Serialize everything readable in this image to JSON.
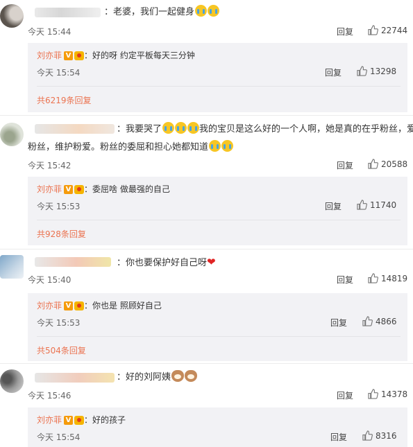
{
  "comments": [
    {
      "text": "：老婆，我们一起健身",
      "time": "今天 15:44",
      "reply_label": "回复",
      "likes": "22744",
      "reply": {
        "name": "刘亦菲",
        "text": "：好的呀 约定平板每天三分钟",
        "time": "今天 15:54",
        "reply_label": "回复",
        "likes": "13298"
      },
      "more": "共6219条回复"
    },
    {
      "text_a": "：我要哭了",
      "text_b": "我的宝贝是这么好的一个人啊，她是真的在乎粉丝，爱",
      "text_c": "粉丝，维护粉爱。粉丝的委屈和担心她都知道",
      "time": "今天 15:42",
      "reply_label": "回复",
      "likes": "20588",
      "reply": {
        "name": "刘亦菲",
        "text": "：委屈啥 做最强的自己",
        "time": "今天 15:53",
        "reply_label": "回复",
        "likes": "11740"
      },
      "more": "共928条回复"
    },
    {
      "text": "：你也要保护好自己呀",
      "time": "今天 15:40",
      "reply_label": "回复",
      "likes": "14819",
      "reply": {
        "name": "刘亦菲",
        "text": "：你也是 照顾好自己",
        "time": "今天 15:53",
        "reply_label": "回复",
        "likes": "4866"
      },
      "more": "共504条回复"
    },
    {
      "text": "：好的刘阿姨",
      "time": "今天 15:46",
      "reply_label": "回复",
      "likes": "14378",
      "reply": {
        "name": "刘亦菲",
        "text": "：好的孩子",
        "time": "今天 15:54",
        "reply_label": "回复",
        "likes": "8316"
      }
    }
  ],
  "icons": {
    "like": "thumbs-up-icon",
    "verified": "verified-v-icon",
    "vip": "vip-crown-icon"
  },
  "colors": {
    "reply_bg": "#f2f2f5",
    "author_name": "#eb7350",
    "link": "#eb7350"
  }
}
